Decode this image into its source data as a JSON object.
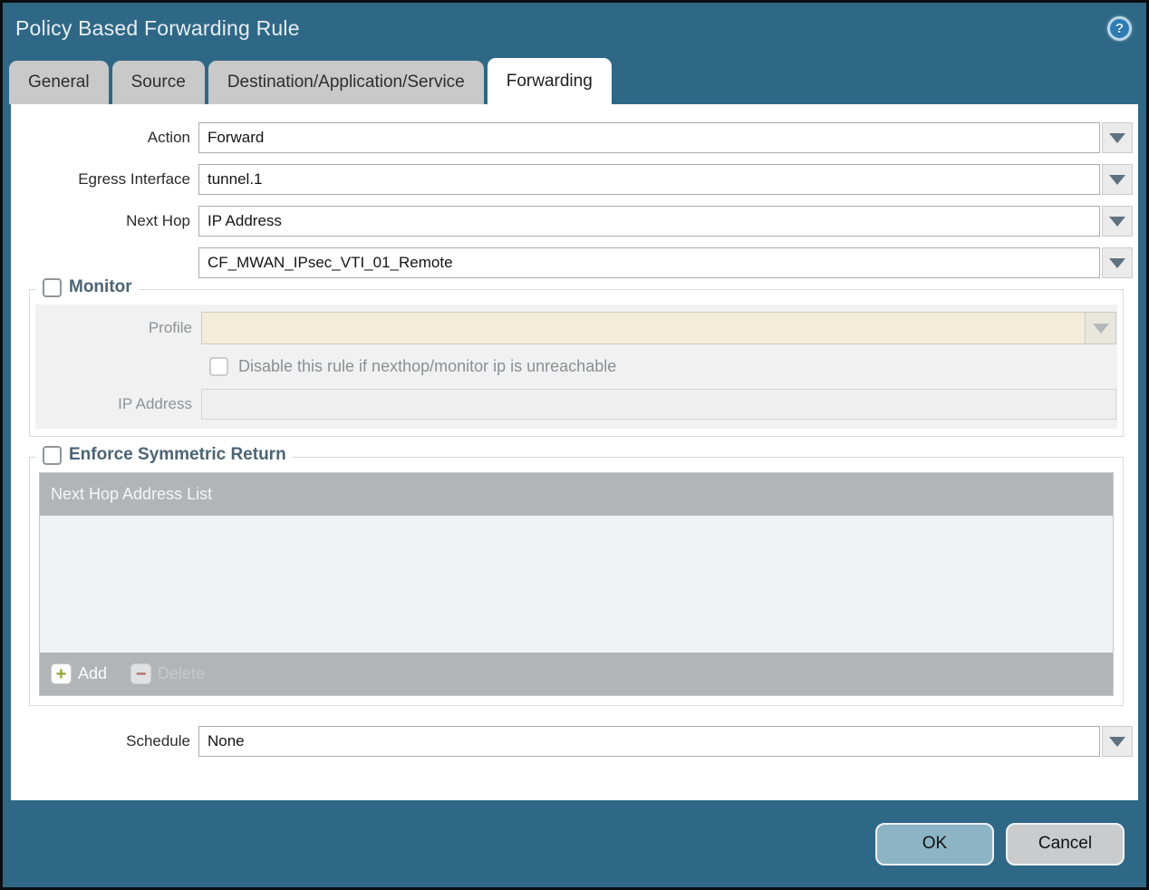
{
  "dialog": {
    "title": "Policy Based Forwarding Rule",
    "help_glyph": "?",
    "accent_color": "#2f6886"
  },
  "tabs": [
    {
      "label": "General",
      "active": false
    },
    {
      "label": "Source",
      "active": false
    },
    {
      "label": "Destination/Application/Service",
      "active": false
    },
    {
      "label": "Forwarding",
      "active": true
    }
  ],
  "form": {
    "action": {
      "label": "Action",
      "value": "Forward"
    },
    "egress_interface": {
      "label": "Egress Interface",
      "value": "tunnel.1"
    },
    "next_hop": {
      "label": "Next Hop",
      "value": "IP Address"
    },
    "next_hop_address": {
      "value": "CF_MWAN_IPsec_VTI_01_Remote"
    },
    "schedule": {
      "label": "Schedule",
      "value": "None"
    }
  },
  "monitor": {
    "title": "Monitor",
    "checked": false,
    "profile_label": "Profile",
    "profile_value": "",
    "disable_checkbox_label": "Disable this rule if nexthop/monitor ip is unreachable",
    "disable_checkbox_checked": false,
    "ip_address_label": "IP Address",
    "ip_address_value": ""
  },
  "symmetric_return": {
    "title": "Enforce Symmetric Return",
    "checked": false,
    "table_header": "Next Hop Address List",
    "rows": [],
    "add_icon": "+",
    "add_label": "Add",
    "delete_icon": "−",
    "delete_label": "Delete"
  },
  "footer": {
    "ok_label": "OK",
    "cancel_label": "Cancel"
  }
}
